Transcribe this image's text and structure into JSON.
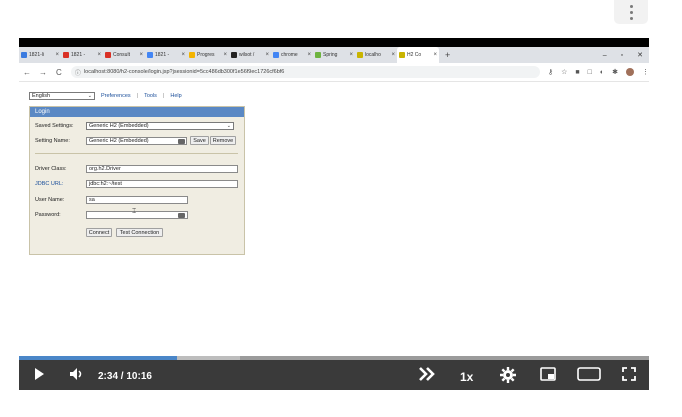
{
  "browser": {
    "tabs": [
      {
        "label": "1821-li",
        "icon": "triangle-app-icon",
        "color": "#3b7be0"
      },
      {
        "label": "1821 - ",
        "icon": "red-square-icon",
        "color": "#d93025"
      },
      {
        "label": "Consult",
        "icon": "red-square-icon",
        "color": "#d93025"
      },
      {
        "label": "1821 - ",
        "icon": "doc-icon",
        "color": "#4285f4"
      },
      {
        "label": "Progres",
        "icon": "note-icon",
        "color": "#f4b400"
      },
      {
        "label": "wilsot /",
        "icon": "github-icon",
        "color": "#222222"
      },
      {
        "label": "chrome",
        "icon": "google-icon",
        "color": "#4285f4"
      },
      {
        "label": "Spring",
        "icon": "spring-icon",
        "color": "#6db33f"
      },
      {
        "label": "localho",
        "icon": "leaf-icon",
        "color": "#c9b400"
      },
      {
        "label": "H2 Co",
        "icon": "leaf-icon",
        "color": "#c9b400",
        "active": true
      }
    ],
    "tab_close_glyph": "×",
    "new_tab_glyph": "+",
    "window_controls": [
      "–",
      "▫",
      "✕"
    ],
    "url": "localhost:8080/h2-console/login.jsp?jsessionid=5cc486db300f1e56f9ec1726cf6bf6"
  },
  "h2": {
    "language": "English",
    "preferences": "Preferences",
    "tools": "Tools",
    "help": "Help",
    "separator": "|",
    "login_title": "Login",
    "saved_settings_label": "Saved Settings:",
    "saved_settings_value": "Generic H2 (Embedded)",
    "setting_name_label": "Setting Name:",
    "setting_name_value": "Generic H2 (Embedded)",
    "save_button": "Save",
    "remove_button": "Remove",
    "driver_class_label": "Driver Class:",
    "driver_class_value": "org.h2.Driver",
    "jdbc_url_label": "JDBC URL:",
    "jdbc_url_value": "jdbc:h2:~/test",
    "user_name_label": "User Name:",
    "user_name_value": "sa",
    "password_label": "Password:",
    "password_value": "",
    "connect_button": "Connect",
    "test_connection_button": "Test Connection"
  },
  "player": {
    "current_time": "2:34",
    "time_separator": "/",
    "duration": "10:16",
    "speed": "1x",
    "progress_fraction": 0.25,
    "buffered_fraction": 0.35,
    "accent": "#4a86c8"
  }
}
